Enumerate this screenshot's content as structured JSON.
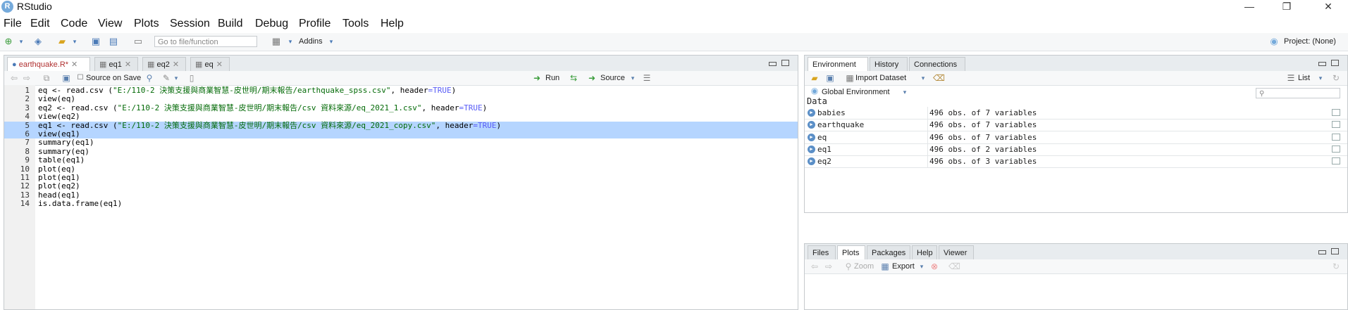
{
  "window": {
    "title": "RStudio",
    "minimize": "—",
    "maximize": "❐",
    "close": "✕"
  },
  "menu": [
    "File",
    "Edit",
    "Code",
    "View",
    "Plots",
    "Session",
    "Build",
    "Debug",
    "Profile",
    "Tools",
    "Help"
  ],
  "toolbar": {
    "goto_placeholder": "Go to file/function",
    "addins_label": "Addins",
    "project_label": "Project: (None)"
  },
  "source_pane": {
    "tabs": [
      {
        "label": "earthquake.R*",
        "active": true
      },
      {
        "label": "eq1",
        "active": false
      },
      {
        "label": "eq2",
        "active": false
      },
      {
        "label": "eq",
        "active": false
      }
    ],
    "source_on_save": "Source on Save",
    "run_label": "Run",
    "source_label": "Source",
    "lines": [
      {
        "n": "1",
        "pre": "eq <- read.csv (",
        "str": "\"E:/110-2 決策支援與商業智慧-皮世明/期末報告/earthquake_spss.csv\"",
        "post": ", header",
        "kw": "=TRUE",
        "end": ")"
      },
      {
        "n": "2",
        "pre": "view(eq)"
      },
      {
        "n": "3",
        "pre": "eq2 <- read.csv (",
        "str": "\"E:/110-2 決策支援與商業智慧-皮世明/期末報告/csv 資料來源/eq_2021_1.csv\"",
        "post": ", header",
        "kw": "=TRUE",
        "end": ")"
      },
      {
        "n": "4",
        "pre": "view(eq2)"
      },
      {
        "n": "5",
        "pre": "eq1 <- read.csv (",
        "str": "\"E:/110-2 決策支援與商業智慧-皮世明/期末報告/csv 資料來源/eq_2021_copy.csv\"",
        "post": ", header",
        "kw": "=TRUE",
        "end": ")",
        "selected": true
      },
      {
        "n": "6",
        "pre": "view(eq1)",
        "selected": true
      },
      {
        "n": "7",
        "pre": "summary(eq1)"
      },
      {
        "n": "8",
        "pre": "summary(eq)"
      },
      {
        "n": "9",
        "pre": "table(eq1)"
      },
      {
        "n": "10",
        "pre": "plot(eq)"
      },
      {
        "n": "11",
        "pre": "plot(eq1)"
      },
      {
        "n": "12",
        "pre": "plot(eq2)"
      },
      {
        "n": "13",
        "pre": "head(eq1)"
      },
      {
        "n": "14",
        "pre": "is.data.frame(eq1)"
      }
    ]
  },
  "env_pane": {
    "tabs": [
      {
        "label": "Environment",
        "active": true
      },
      {
        "label": "History",
        "active": false
      },
      {
        "label": "Connections",
        "active": false
      }
    ],
    "import_label": "Import Dataset",
    "list_label": "List",
    "scope_label": "Global Environment",
    "section_label": "Data",
    "rows": [
      {
        "name": "babies",
        "value": "496 obs. of 7 variables"
      },
      {
        "name": "earthquake",
        "value": "496 obs. of 7 variables"
      },
      {
        "name": "eq",
        "value": "496 obs. of 7 variables"
      },
      {
        "name": "eq1",
        "value": "496 obs. of 2 variables"
      },
      {
        "name": "eq2",
        "value": "496 obs. of 3 variables"
      }
    ]
  },
  "files_pane": {
    "tabs": [
      {
        "label": "Files",
        "active": false
      },
      {
        "label": "Plots",
        "active": true
      },
      {
        "label": "Packages",
        "active": false
      },
      {
        "label": "Help",
        "active": false
      },
      {
        "label": "Viewer",
        "active": false
      }
    ],
    "zoom_label": "Zoom",
    "export_label": "Export"
  }
}
